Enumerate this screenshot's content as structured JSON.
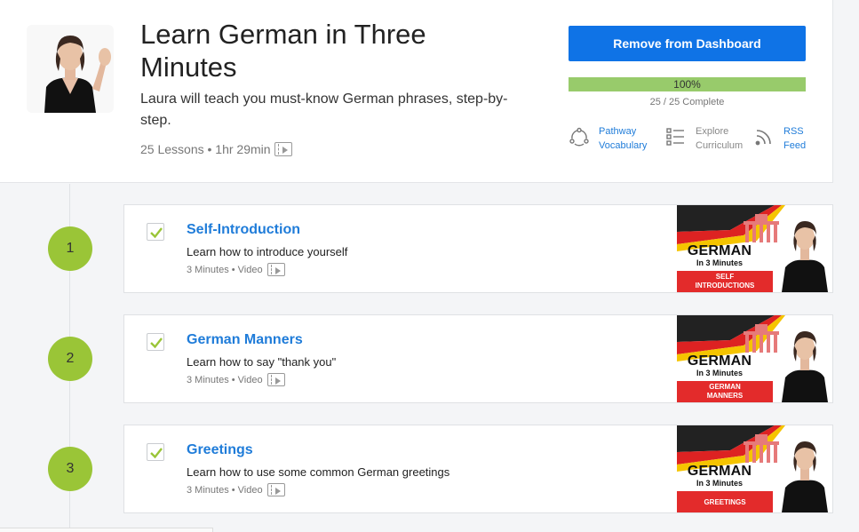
{
  "course": {
    "title": "Learn German in Three Minutes",
    "description": "Laura will teach you must-know German phrases, step-by-step.",
    "meta": "25 Lessons • 1hr 29min"
  },
  "actions": {
    "remove_label": "Remove from Dashboard",
    "progress_percent_label": "100%",
    "progress_fraction": 1.0,
    "progress_text": "25 / 25 Complete"
  },
  "links": [
    {
      "line1": "Pathway",
      "line2": "Vocabulary",
      "icon": "pathway-icon"
    },
    {
      "line1": "Explore",
      "line2": "Curriculum",
      "icon": "list-icon"
    },
    {
      "line1": "RSS",
      "line2": "Feed",
      "icon": "rss-icon"
    }
  ],
  "lessons": [
    {
      "number": "1",
      "title": "Self-Introduction",
      "description": "Learn how to introduce yourself",
      "meta": "3 Minutes • Video",
      "thumb_title": "GERMAN",
      "thumb_sub": "In 3 Minutes",
      "thumb_banner_1": "SELF",
      "thumb_banner_2": "INTRODUCTIONS"
    },
    {
      "number": "2",
      "title": "German Manners",
      "description": "Learn how to say \"thank you\"",
      "meta": "3 Minutes • Video",
      "thumb_title": "GERMAN",
      "thumb_sub": "In 3 Minutes",
      "thumb_banner_1": "GERMAN",
      "thumb_banner_2": "MANNERS"
    },
    {
      "number": "3",
      "title": "Greetings",
      "description": "Learn how to use some common German greetings",
      "meta": "3 Minutes • Video",
      "thumb_title": "GERMAN",
      "thumb_sub": "In 3 Minutes",
      "thumb_banner_1": "GREETINGS",
      "thumb_banner_2": ""
    }
  ],
  "colors": {
    "accent_blue": "#0f73e6",
    "link_blue": "#1f7cd9",
    "progress_green": "#98cb6b",
    "step_green": "#9ac537",
    "thumb_red": "#e32b2b"
  }
}
